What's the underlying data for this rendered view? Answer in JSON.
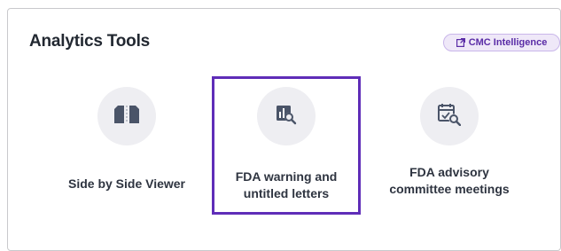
{
  "header": {
    "title": "Analytics Tools",
    "badge_label": "CMC Intelligence",
    "badge_icon": "external-link-icon"
  },
  "tools": [
    {
      "label": "Side by Side Viewer",
      "icon": "split-document-icon",
      "selected": false
    },
    {
      "label": "FDA warning and untitled letters",
      "icon": "chart-search-icon",
      "selected": true
    },
    {
      "label": "FDA advisory committee meetings",
      "icon": "calendar-search-icon",
      "selected": false
    }
  ],
  "colors": {
    "accent": "#5f2db8",
    "icon": "#4a5468",
    "icon_circle": "#eeeef2",
    "badge_bg": "#efe8f8"
  }
}
